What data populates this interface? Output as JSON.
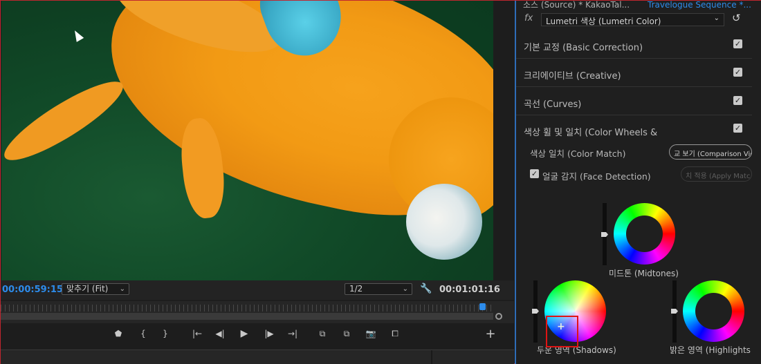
{
  "monitor": {
    "timecode_current": "00:00:59:15",
    "fit_label": "맞추기 (Fit)",
    "resolution": "1/2",
    "timecode_duration": "00:01:01:16",
    "playhead_fraction": 0.97
  },
  "panel": {
    "source_line": "소스 (Source) * KakaoTal...",
    "sequence_line": "Travelogue Sequence *...",
    "fx_label": "fx",
    "effect_name": "Lumetri 색상 (Lumetri Color)",
    "sections": [
      {
        "label": "기본 교정 (Basic Correction)",
        "checked": true
      },
      {
        "label": "크리에이티브 (Creative)",
        "checked": true
      },
      {
        "label": "곡선 (Curves)",
        "checked": true
      },
      {
        "label": "색상 휠 및 일치 (Color Wheels &",
        "checked": true
      }
    ],
    "color_match_label": "색상 일치 (Color Match)",
    "comparison_button": "교 보기 (Comparison Vie",
    "face_detection_label": "얼굴 감지 (Face Detection)",
    "apply_match_button": "치 적용 (Apply Matc",
    "wheels": {
      "midtones": "미드톤 (Midtones)",
      "shadows": "두운 영역 (Shadows)",
      "highlights": "밝은 영역 (Highlights"
    }
  },
  "colors": {
    "accent_blue": "#2d8ceb",
    "border_red": "#c0262f",
    "highlight_box": "#e01414"
  }
}
